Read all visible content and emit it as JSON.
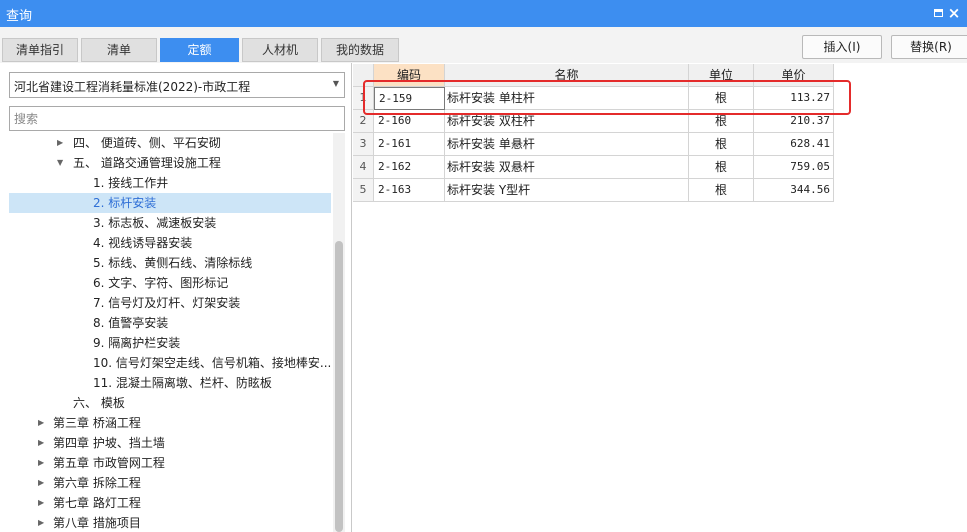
{
  "window": {
    "title": "查询"
  },
  "tabs": [
    "清单指引",
    "清单",
    "定额",
    "人材机",
    "我的数据"
  ],
  "active_tab": "定额",
  "actions": {
    "insert_label": "插入(I)",
    "replace_label": "替换(R)"
  },
  "left": {
    "standard_select": "河北省建设工程消耗量标准(2022)-市政工程",
    "search_placeholder": "搜索",
    "tree": [
      {
        "label": "四、 便道砖、侧、平石安砌",
        "level": 1,
        "caret": "collapsed"
      },
      {
        "label": "五、 道路交通管理设施工程",
        "level": 1,
        "caret": "expanded"
      },
      {
        "label": "1. 接线工作井",
        "level": 2
      },
      {
        "label": "2. 标杆安装",
        "level": 2,
        "selected": true
      },
      {
        "label": "3. 标志板、减速板安装",
        "level": 2
      },
      {
        "label": "4. 视线诱导器安装",
        "level": 2
      },
      {
        "label": "5. 标线、黄侧石线、清除标线",
        "level": 2
      },
      {
        "label": "6. 文字、字符、图形标记",
        "level": 2
      },
      {
        "label": "7. 信号灯及灯杆、灯架安装",
        "level": 2
      },
      {
        "label": "8. 值警亭安装",
        "level": 2
      },
      {
        "label": "9. 隔离护栏安装",
        "level": 2
      },
      {
        "label": "10. 信号灯架空走线、信号机箱、接地棒安...",
        "level": 2
      },
      {
        "label": "11. 混凝土隔离墩、栏杆、防眩板",
        "level": 2
      },
      {
        "label": "六、 模板",
        "level": 1
      },
      {
        "label": "第三章 桥涵工程",
        "level": 0,
        "caret": "collapsed"
      },
      {
        "label": "第四章 护坡、挡土墙",
        "level": 0,
        "caret": "collapsed"
      },
      {
        "label": "第五章 市政管网工程",
        "level": 0,
        "caret": "collapsed"
      },
      {
        "label": "第六章 拆除工程",
        "level": 0,
        "caret": "collapsed"
      },
      {
        "label": "第七章 路灯工程",
        "level": 0,
        "caret": "collapsed"
      },
      {
        "label": "第八章 措施项目",
        "level": 0,
        "caret": "collapsed"
      }
    ]
  },
  "table": {
    "columns": [
      "编码",
      "名称",
      "单位",
      "单价"
    ],
    "rows": [
      {
        "num": "1",
        "code": "2-159",
        "name": "标杆安装 单柱杆",
        "unit": "根",
        "price": "113.27"
      },
      {
        "num": "2",
        "code": "2-160",
        "name": "标杆安装 双柱杆",
        "unit": "根",
        "price": "210.37"
      },
      {
        "num": "3",
        "code": "2-161",
        "name": "标杆安装 单悬杆",
        "unit": "根",
        "price": "628.41"
      },
      {
        "num": "4",
        "code": "2-162",
        "name": "标杆安装 双悬杆",
        "unit": "根",
        "price": "759.05"
      },
      {
        "num": "5",
        "code": "2-163",
        "name": "标杆安装 Y型杆",
        "unit": "根",
        "price": "344.56"
      }
    ]
  },
  "colors": {
    "accent": "#3d8ef0",
    "highlight_box": "#e42b2b",
    "selected_tree_bg": "#cde5f7",
    "sorted_header_bg": "#fce1c4"
  },
  "icons": {
    "restore": "restore-icon",
    "close": "close-icon",
    "dropdown": "chevron-down-icon",
    "tree_collapsed": "caret-right-icon",
    "tree_expanded": "caret-down-icon"
  }
}
